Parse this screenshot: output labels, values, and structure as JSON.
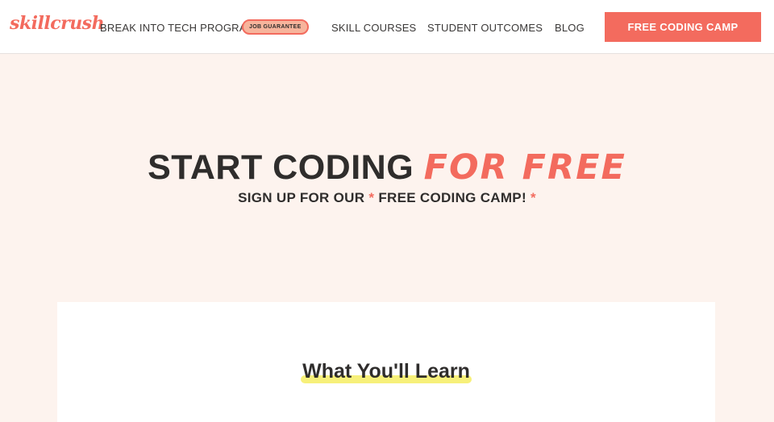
{
  "nav": {
    "logo": "skillcrush",
    "links": [
      {
        "label": "BREAK INTO TECH PROGRAM"
      },
      {
        "label": "SKILL COURSES"
      },
      {
        "label": "STUDENT OUTCOMES"
      },
      {
        "label": "BLOG"
      }
    ],
    "badge": "JOB GUARANTEE",
    "cta": "FREE CODING CAMP"
  },
  "hero": {
    "title_main": "START CODING",
    "title_accent": "FOR FREE",
    "subtitle_before": "SIGN UP FOR OUR",
    "subtitle_star": "*",
    "subtitle_middle": "FREE CODING CAMP!",
    "subtitle_star2": "*"
  },
  "card": {
    "heading": "What You'll Learn"
  },
  "colors": {
    "accent": "#f36b5e",
    "background": "#fdf3ee",
    "highlight": "#f7f07a",
    "text": "#2f2d2c"
  }
}
